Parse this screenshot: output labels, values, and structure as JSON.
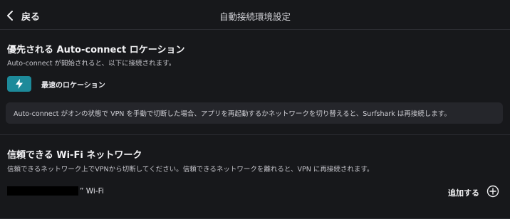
{
  "header": {
    "back_label": "戻る",
    "title": "自動接続環境設定"
  },
  "preferred_location": {
    "title": "優先される Auto-connect ロケーション",
    "description": "Auto-connect が開始されると、以下に接続されます。",
    "location_label": "最速のロケーション",
    "location_icon": "lightning-bolt-icon",
    "accent_color": "#1d8a9a",
    "info": "Auto-connect がオンの状態で VPN を手動で切断した場合、アプリを再起動するかネットワークを切り替えると、Surfshark は再接続します。"
  },
  "trusted_wifi": {
    "title": "信頼できる Wi-Fi ネットワーク",
    "description": "信頼できるネットワーク上でVPNから切断してください。信頼できるネットワークを離れると、VPN に再接続されます。",
    "network_suffix": "” Wi-Fi",
    "add_label": "追加する",
    "add_icon": "plus-circle-icon"
  }
}
